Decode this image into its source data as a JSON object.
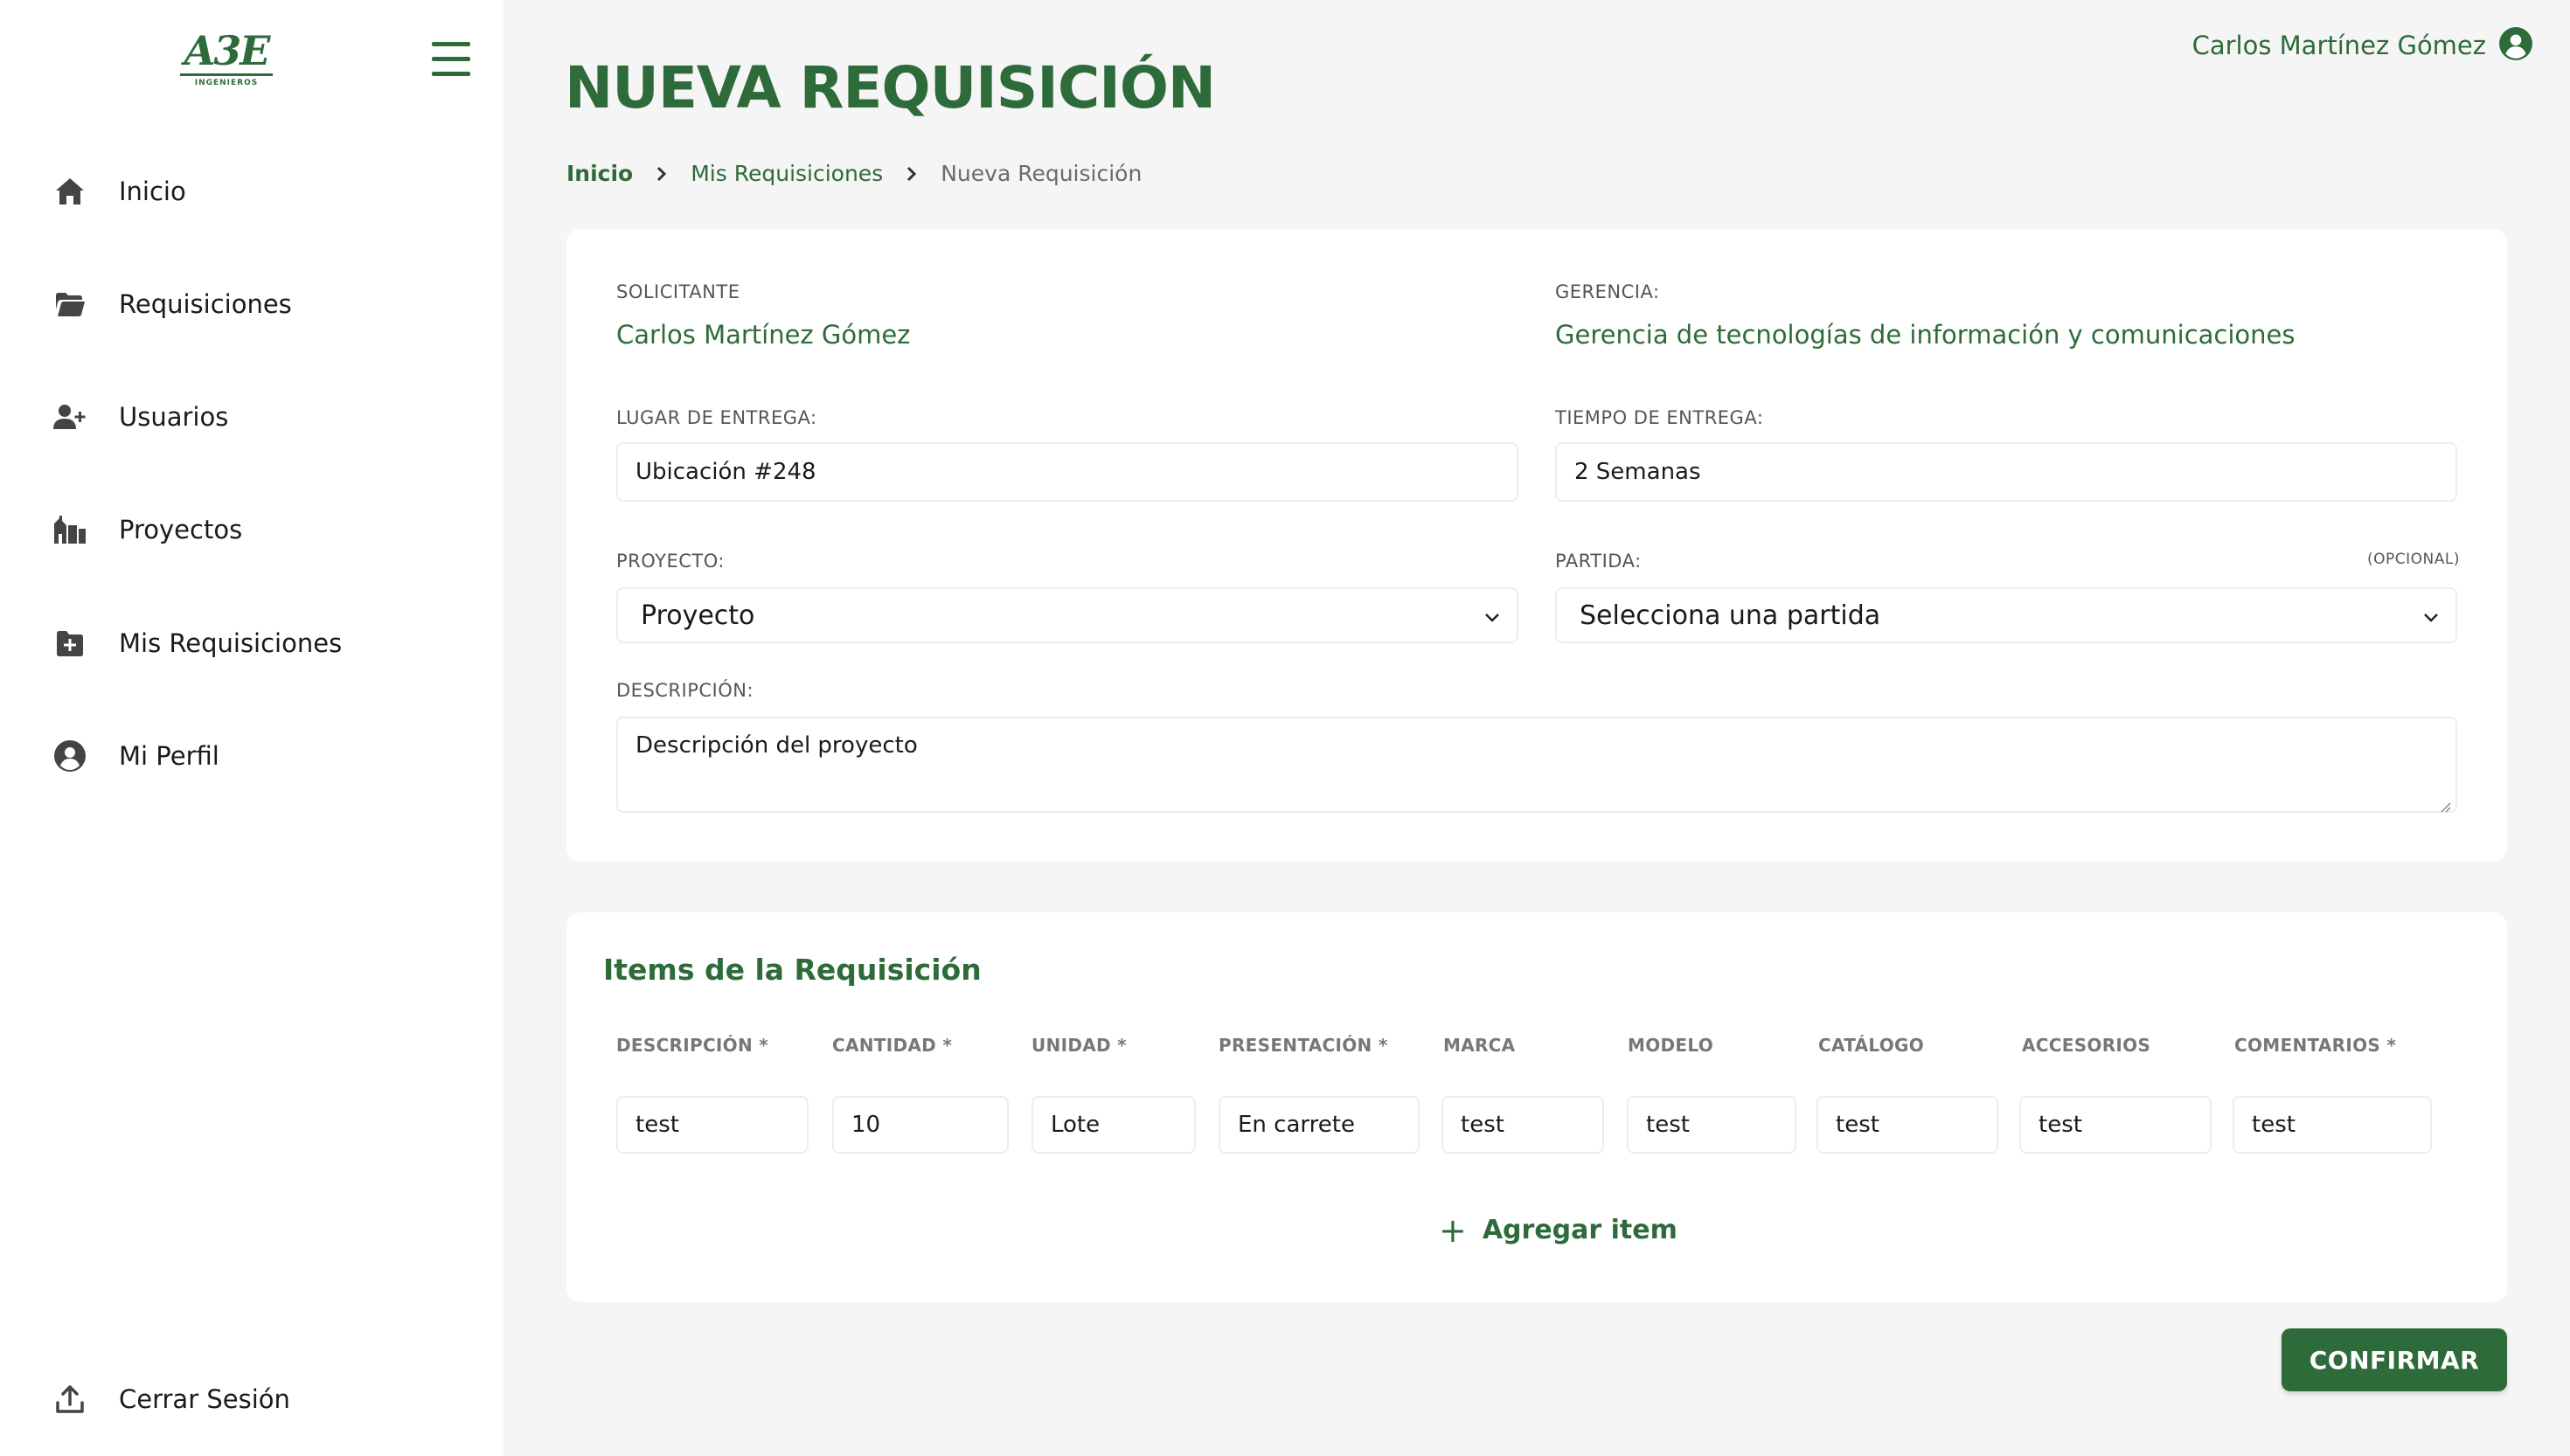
{
  "logo": {
    "text": "A3E",
    "subtext": "INGENIEROS"
  },
  "sidebar": {
    "items": [
      {
        "label": "Inicio",
        "icon": "home-icon"
      },
      {
        "label": "Requisiciones",
        "icon": "folder-open-icon"
      },
      {
        "label": "Usuarios",
        "icon": "user-plus-icon"
      },
      {
        "label": "Proyectos",
        "icon": "building-icon"
      },
      {
        "label": "Mis Requisiciones",
        "icon": "folder-plus-icon"
      },
      {
        "label": "Mi Perfil",
        "icon": "user-circle-icon"
      }
    ],
    "logout": {
      "label": "Cerrar Sesión",
      "icon": "upload-icon"
    }
  },
  "header": {
    "user_name": "Carlos Martínez Gómez",
    "title": "NUEVA REQUISICIÓN"
  },
  "breadcrumb": {
    "home": "Inicio",
    "parent": "Mis Requisiciones",
    "current": "Nueva Requisición"
  },
  "form": {
    "solicitante_label": "SOLICITANTE",
    "solicitante_value": "Carlos Martínez Gómez",
    "gerencia_label": "GERENCIA:",
    "gerencia_value": "Gerencia de tecnologías de información y comunicaciones",
    "lugar_label": "LUGAR DE ENTREGA:",
    "lugar_value": "Ubicación #248",
    "tiempo_label": "TIEMPO DE ENTREGA:",
    "tiempo_value": "2 Semanas",
    "proyecto_label": "PROYECTO:",
    "proyecto_value": "Proyecto",
    "partida_label": "PARTIDA:",
    "partida_optional": "(OPCIONAL)",
    "partida_value": "Selecciona una partida",
    "descripcion_label": "DESCRIPCIÓN:",
    "descripcion_value": "Descripción del proyecto"
  },
  "items": {
    "title": "Items de la Requisición",
    "columns": [
      "DESCRIPCIÓN *",
      "CANTIDAD *",
      "UNIDAD *",
      "PRESENTACIÓN *",
      "MARCA",
      "MODELO",
      "CATÁLOGO",
      "ACCESORIOS",
      "COMENTARIOS *"
    ],
    "row": [
      "test",
      "10",
      "Lote",
      "En carrete",
      "test",
      "test",
      "test",
      "test",
      "test"
    ],
    "add_label": "Agregar item"
  },
  "confirm_label": "CONFIRMAR",
  "colors": {
    "brand": "#2e6b3a",
    "background": "#f5f5f5"
  }
}
